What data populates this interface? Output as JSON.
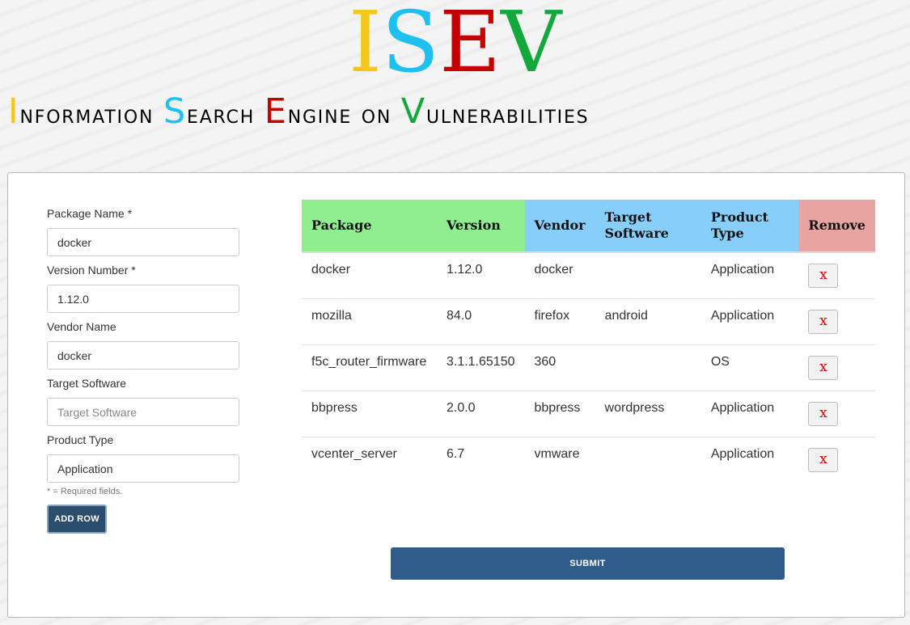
{
  "logo": {
    "l1": "I",
    "l2": "S",
    "l3": "E",
    "l4": "V"
  },
  "subtitle": {
    "w1_first": "I",
    "w1_rest": "nformation",
    "w2_first": "S",
    "w2_rest": "earch",
    "w3_first": "E",
    "w3_rest": "ngine",
    "w4": "on",
    "w5_first": "V",
    "w5_rest": "ulnerabilities"
  },
  "colors": {
    "yellow": "#f5c518",
    "blue": "#1ec0f0",
    "red": "#c40000",
    "green": "#14a83c",
    "submit": "#2f5c8a"
  },
  "form": {
    "package_label": "Package Name *",
    "package_value": "docker",
    "version_label": "Version Number *",
    "version_value": "1.12.0",
    "vendor_label": "Vendor Name",
    "vendor_value": "docker",
    "target_label": "Target Software",
    "target_value": "",
    "target_placeholder": "Target Software",
    "type_label": "Product Type",
    "type_value": "Application",
    "required_note": "* = Required fields.",
    "add_row": "ADD ROW"
  },
  "table": {
    "headers": {
      "package": "Package",
      "version": "Version",
      "vendor": "Vendor",
      "target": "Target Software",
      "type": "Product Type",
      "remove": "Remove"
    },
    "rows": [
      {
        "package": "docker",
        "version": "1.12.0",
        "vendor": "docker",
        "target": "",
        "type": "Application",
        "remove": "x"
      },
      {
        "package": "mozilla",
        "version": "84.0",
        "vendor": "firefox",
        "target": "android",
        "type": "Application",
        "remove": "x"
      },
      {
        "package": "f5c_router_firmware",
        "version": "3.1.1.65150",
        "vendor": "360",
        "target": "",
        "type": "OS",
        "remove": "x"
      },
      {
        "package": "bbpress",
        "version": "2.0.0",
        "vendor": "bbpress",
        "target": "wordpress",
        "type": "Application",
        "remove": "x"
      },
      {
        "package": "vcenter_server",
        "version": "6.7",
        "vendor": "vmware",
        "target": "",
        "type": "Application",
        "remove": "x"
      }
    ]
  },
  "submit": "SUBMIT"
}
